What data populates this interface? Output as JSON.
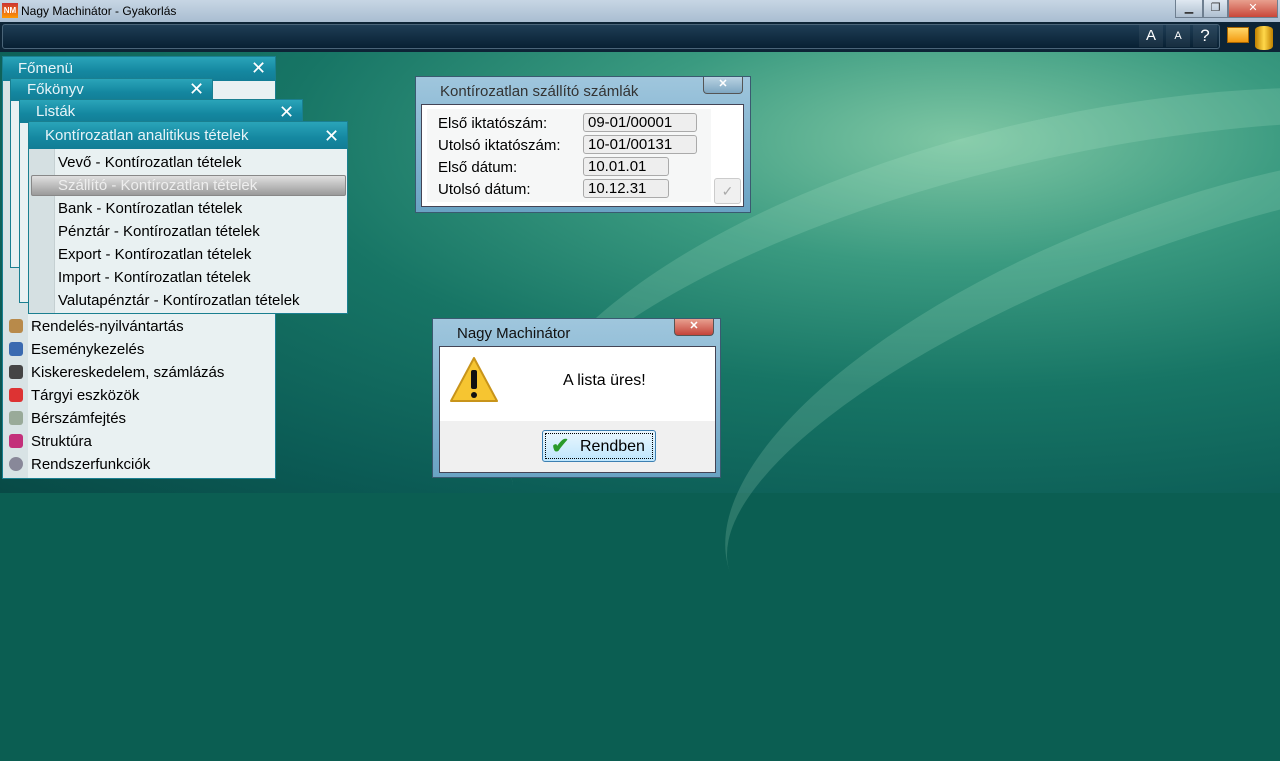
{
  "window": {
    "title": "Nagy Machinátor - Gyakorlás",
    "app_icon": "NM"
  },
  "toolbar": {
    "font_large": "A",
    "font_small": "A",
    "help": "?"
  },
  "windows": {
    "fomenu": {
      "title": "Főmenü",
      "items": [
        "Rendelés-nyilvántartás",
        "Eseménykezelés",
        "Kiskereskedelem, számlázás",
        "Tárgyi eszközök",
        "Bérszámfejtés",
        "Struktúra",
        "Rendszerfunkciók"
      ]
    },
    "fokonyv": {
      "title": "Főkönyv"
    },
    "listak": {
      "title": "Listák"
    },
    "analitikus": {
      "title": "Kontírozatlan analitikus tételek",
      "items": [
        "Vevő - Kontírozatlan tételek",
        "Szállító - Kontírozatlan tételek",
        "Bank - Kontírozatlan tételek",
        "Pénztár - Kontírozatlan tételek",
        "Export - Kontírozatlan tételek",
        "Import - Kontírozatlan tételek",
        "Valutapénztár - Kontírozatlan tételek"
      ],
      "selected": 1
    }
  },
  "dialog_szamlak": {
    "title": "Kontírozatlan szállító számlák",
    "fields": [
      {
        "label": "Első iktatószám:",
        "value": "09-01/00001"
      },
      {
        "label": "Utolsó iktatószám:",
        "value": "10-01/00131"
      },
      {
        "label": "Első dátum:",
        "value": "10.01.01"
      },
      {
        "label": "Utolsó dátum:",
        "value": "10.12.31"
      }
    ]
  },
  "dialog_msg": {
    "title": "Nagy Machinátor",
    "message": "A lista üres!",
    "ok_label": "Rendben"
  }
}
